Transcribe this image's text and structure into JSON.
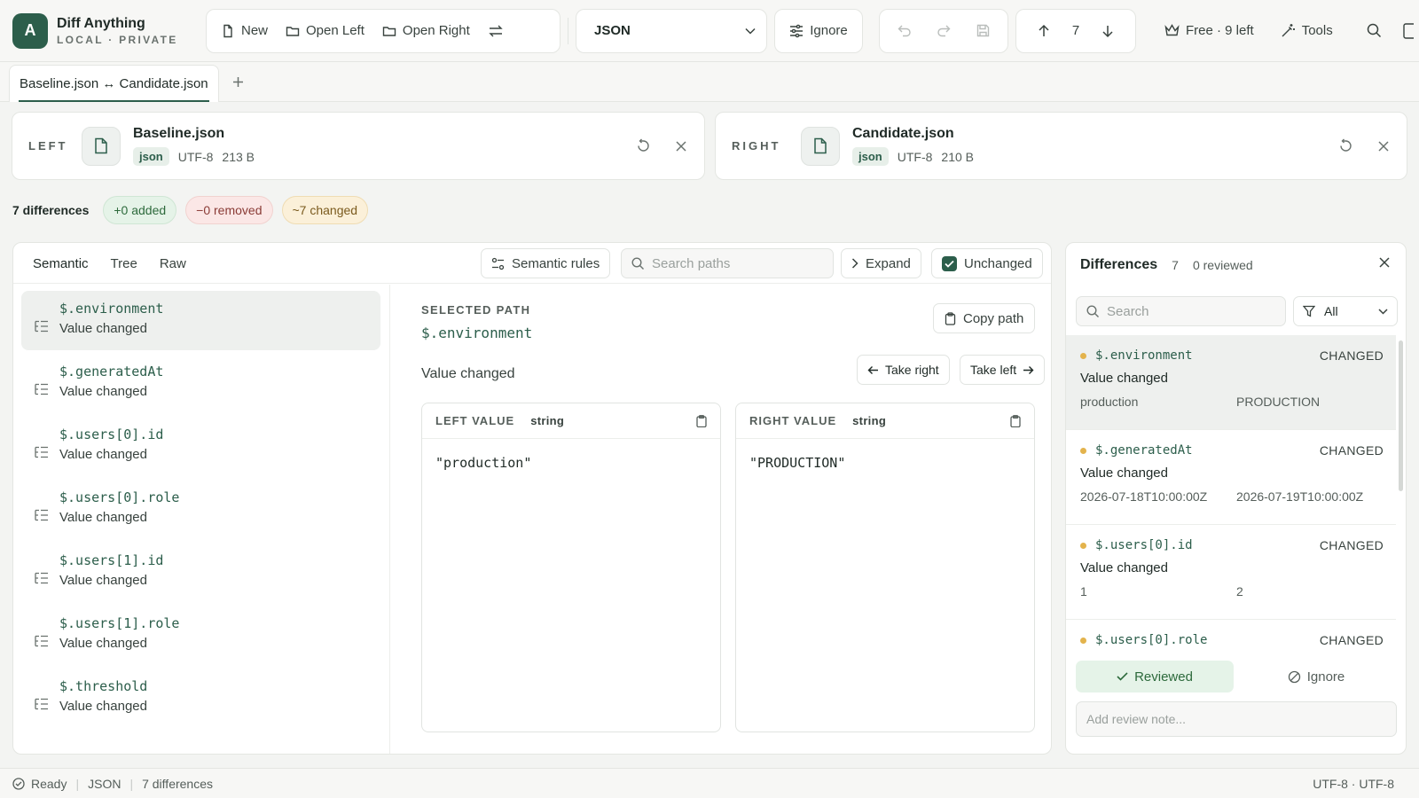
{
  "app": {
    "name": "Diff Anything",
    "subtitle": "LOCAL · PRIVATE",
    "logo_letter": "A"
  },
  "toolbar": {
    "new": "New",
    "open_left": "Open Left",
    "open_right": "Open Right",
    "format": "JSON",
    "ignore": "Ignore",
    "nav_index": "7",
    "plan": "Free · 9 left",
    "tools": "Tools"
  },
  "tabs": [
    {
      "label": "Baseline.json ↔ Candidate.json"
    }
  ],
  "left_file": {
    "side": "LEFT",
    "name": "Baseline.json",
    "format": "json",
    "encoding": "UTF-8",
    "size": "213 B"
  },
  "right_file": {
    "side": "RIGHT",
    "name": "Candidate.json",
    "format": "json",
    "encoding": "UTF-8",
    "size": "210 B"
  },
  "summary": {
    "count": "7 differences",
    "added": "+0 added",
    "removed": "−0 removed",
    "changed": "~7 changed"
  },
  "view": {
    "tabs": [
      "Semantic",
      "Tree",
      "Raw"
    ],
    "semantic_rules": "Semantic rules",
    "search_placeholder": "Search paths",
    "expand": "Expand",
    "unchanged": "Unchanged"
  },
  "paths": [
    {
      "path": "$.environment",
      "desc": "Value changed"
    },
    {
      "path": "$.generatedAt",
      "desc": "Value changed"
    },
    {
      "path": "$.users[0].id",
      "desc": "Value changed"
    },
    {
      "path": "$.users[0].role",
      "desc": "Value changed"
    },
    {
      "path": "$.users[1].id",
      "desc": "Value changed"
    },
    {
      "path": "$.users[1].role",
      "desc": "Value changed"
    },
    {
      "path": "$.threshold",
      "desc": "Value changed"
    }
  ],
  "detail": {
    "selected_label": "SELECTED PATH",
    "path": "$.environment",
    "copy_path": "Copy path",
    "change_type": "Value changed",
    "take_right": "Take right",
    "take_left": "Take left",
    "left": {
      "label": "LEFT VALUE",
      "type": "string",
      "value": "\"production\""
    },
    "right": {
      "label": "RIGHT VALUE",
      "type": "string",
      "value": "\"PRODUCTION\""
    }
  },
  "differences": {
    "title": "Differences",
    "count": "7",
    "reviewed": "0 reviewed",
    "search_placeholder": "Search",
    "filter": "All",
    "items": [
      {
        "path": "$.environment",
        "status": "CHANGED",
        "desc": "Value changed",
        "left": "production",
        "right": "PRODUCTION"
      },
      {
        "path": "$.generatedAt",
        "status": "CHANGED",
        "desc": "Value changed",
        "left": "2026-07-18T10:00:00Z",
        "right": "2026-07-19T10:00:00Z"
      },
      {
        "path": "$.users[0].id",
        "status": "CHANGED",
        "desc": "Value changed",
        "left": "1",
        "right": "2"
      },
      {
        "path": "$.users[0].role",
        "status": "CHANGED",
        "desc": "",
        "left": "",
        "right": ""
      }
    ],
    "reviewed_btn": "Reviewed",
    "ignore_btn": "Ignore",
    "note_placeholder": "Add review note..."
  },
  "status": {
    "state": "Ready",
    "format": "JSON",
    "differences": "7 differences",
    "encoding": "UTF-8 · UTF-8"
  },
  "colors": {
    "accent": "#2c5e4b",
    "added": "#2d6a3c",
    "removed": "#8a3b36",
    "changed": "#7a5a1d",
    "dot": "#e3b34c"
  }
}
